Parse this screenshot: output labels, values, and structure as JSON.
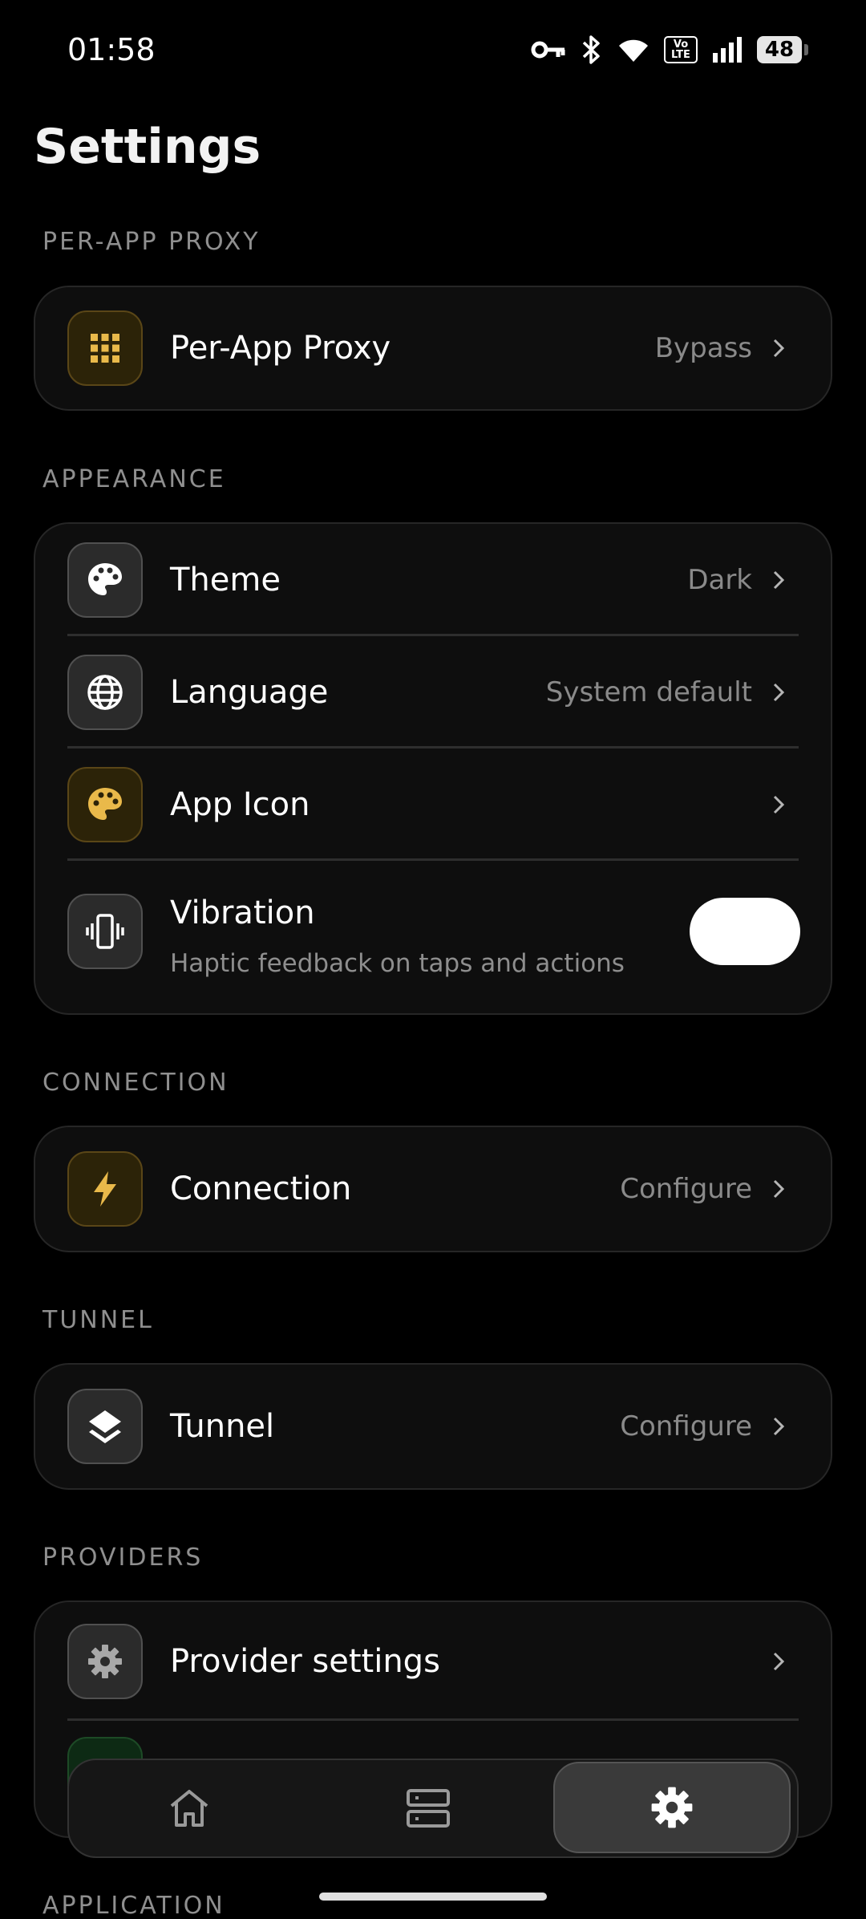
{
  "status": {
    "time": "01:58",
    "volte": "Vo LTE",
    "battery": "48"
  },
  "title": "Settings",
  "sections": {
    "per_app": {
      "label": "PER-APP PROXY",
      "row": {
        "label": "Per-App Proxy",
        "value": "Bypass"
      }
    },
    "appearance": {
      "label": "APPEARANCE",
      "theme": {
        "label": "Theme",
        "value": "Dark"
      },
      "language": {
        "label": "Language",
        "value": "System default"
      },
      "app_icon": {
        "label": "App Icon"
      },
      "vibration": {
        "label": "Vibration",
        "sub": "Haptic feedback on taps and actions",
        "enabled": true
      }
    },
    "connection": {
      "label": "CONNECTION",
      "row": {
        "label": "Connection",
        "value": "Configure"
      }
    },
    "tunnel": {
      "label": "TUNNEL",
      "row": {
        "label": "Tunnel",
        "value": "Configure"
      }
    },
    "providers": {
      "label": "PROVIDERS",
      "row": {
        "label": "Provider settings"
      }
    },
    "application": {
      "label": "APPLICATION"
    }
  },
  "colors": {
    "accent": "#e9b94a",
    "background": "#000000",
    "card": "#0e0e0e"
  },
  "nav": {
    "items": [
      "home-icon",
      "servers-icon",
      "settings-icon"
    ],
    "active": "settings-icon"
  }
}
